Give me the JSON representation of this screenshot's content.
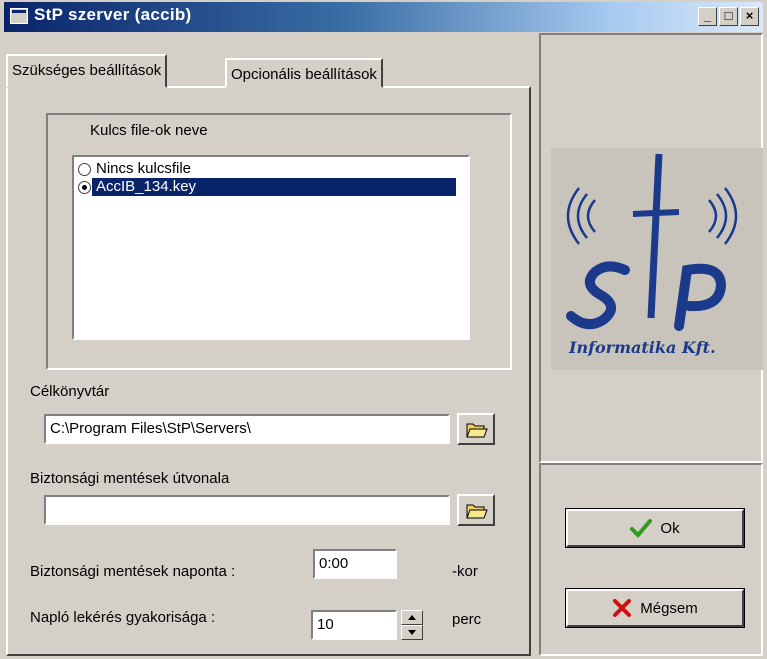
{
  "window": {
    "title": "StP szerver (accib)",
    "controls": [
      "_",
      "□",
      "×"
    ]
  },
  "tabs": [
    {
      "label": "Szükséges beállítások",
      "active": true
    },
    {
      "label": "Opcionális beállítások",
      "active": false
    }
  ],
  "key_files": {
    "group_label": "Kulcs file-ok neve",
    "items": [
      {
        "label": "Nincs kulcsfile",
        "checked": false,
        "selected": false
      },
      {
        "label": "AccIB_134.key",
        "checked": true,
        "selected": true
      }
    ]
  },
  "target_dir": {
    "label": "Célkönyvtár",
    "value": "C:\\Program Files\\StP\\Servers\\"
  },
  "backup_path": {
    "label": "Biztonsági mentések útvonala",
    "value": ""
  },
  "backup_daily": {
    "label": "Biztonsági mentések naponta :",
    "value": "0:00",
    "suffix": "-kor"
  },
  "log_freq": {
    "label": "Napló lekérés gyakorisága :",
    "value": "10",
    "suffix": "perc"
  },
  "logo": {
    "main": "StP",
    "sub": "Informatika Kft."
  },
  "buttons": {
    "ok": "Ok",
    "cancel": "Mégsem"
  },
  "colors": {
    "selection": "#0a246a",
    "logo_blue": "#1b3a8c",
    "ok_check": "#2e9a1e",
    "cancel_x": "#d01010"
  }
}
